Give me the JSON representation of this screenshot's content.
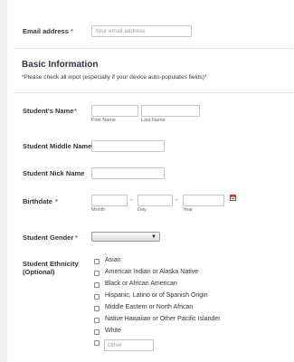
{
  "email": {
    "label": "Email address",
    "required": "*",
    "placeholder": "Your email address"
  },
  "section": {
    "title": "Basic Information",
    "note": "*Please check all input (especially if your device auto-populates fields)*"
  },
  "student_name": {
    "label": "Student's Name",
    "required": "*",
    "first_sublabel": "First Name",
    "last_sublabel": "Last Name"
  },
  "middle_name": {
    "label": "Student Middle Name"
  },
  "nick_name": {
    "label": "Student Nick Name"
  },
  "birthdate": {
    "label": "Birthdate",
    "required": "*",
    "separator": "-",
    "month_sublabel": "Month",
    "day_sublabel": "Day",
    "year_sublabel": "Year",
    "calendar_icon": "calendar-icon"
  },
  "gender": {
    "label": "Student Gender",
    "required": "*",
    "selected": "",
    "dropdown_icon": "dropdown-arrow-icon"
  },
  "ethnicity": {
    "label_line1": "Student Ethnicity",
    "label_line2": "(Optional)",
    "options": [
      "Asian",
      "American Indian or Alaska Native",
      "Black or African American",
      "Hispanic, Latino or of Spanish Origin",
      "Middle Eastern or North African",
      "Native Hawaiian or Other Pacific Islander",
      "White"
    ],
    "other_placeholder": "Other"
  }
}
